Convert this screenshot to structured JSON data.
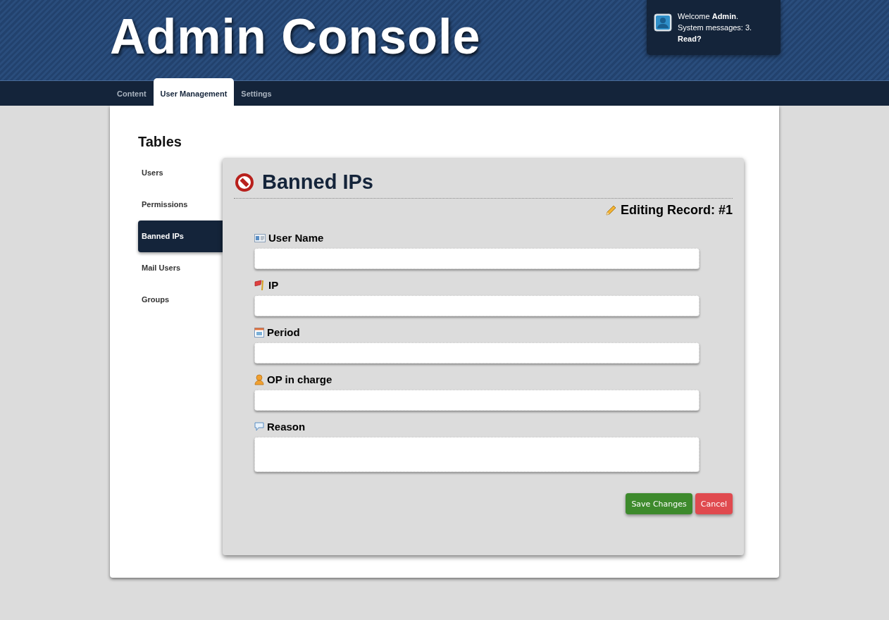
{
  "header": {
    "title": "Admin Console",
    "welcome": "Welcome **Admin**.",
    "messages": "System messages: 3.",
    "read_link": "Read?"
  },
  "tabs": [
    {
      "label": "Content",
      "selected": false
    },
    {
      "label": "User Management",
      "selected": true
    },
    {
      "label": "Settings",
      "selected": false
    }
  ],
  "sidebar": {
    "title": "Tables",
    "items": [
      {
        "label": "Users",
        "selected": false
      },
      {
        "label": "Permissions",
        "selected": false
      },
      {
        "label": "Banned IPs",
        "selected": true
      },
      {
        "label": "Mail Users",
        "selected": false
      },
      {
        "label": "Groups",
        "selected": false
      }
    ]
  },
  "panel": {
    "title": "Banned IPs",
    "subtitle": "Editing Record: #1",
    "fields": [
      {
        "label": "User Name",
        "kind": "text"
      },
      {
        "label": "IP",
        "kind": "text"
      },
      {
        "label": "Period",
        "kind": "text"
      },
      {
        "label": "OP in charge",
        "kind": "text"
      },
      {
        "label": "Reason",
        "kind": "textarea"
      }
    ],
    "buttons": [
      {
        "label": "Save Changes",
        "kind": "primary"
      },
      {
        "label": "Cancel",
        "kind": "danger"
      }
    ]
  }
}
